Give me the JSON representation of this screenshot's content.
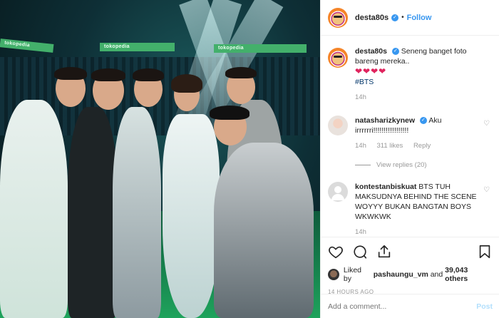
{
  "post": {
    "username": "desta80s",
    "follow_label": "Follow",
    "dot": "•",
    "caption_text": "Seneng banget foto bareng mereka..",
    "caption_hearts": "❤❤❤❤",
    "caption_tag": "#BTS",
    "caption_age": "14h",
    "banner_text": "tokopedia"
  },
  "comments": [
    {
      "username": "natasharizkynew",
      "text": "Aku irrrrrri!!!!!!!!!!!!!!!!!",
      "age": "14h",
      "likes": "311 likes",
      "reply": "Reply",
      "view_replies": "View replies (20)"
    },
    {
      "username": "kontestanbiskuat",
      "text": "BTS TUH MAKSUDNYA BEHIND THE SCENE WOYYY BUKAN BANGTAN BOYS WKWKWK",
      "age": "14h",
      "likes": "",
      "reply": ""
    }
  ],
  "actions": {
    "liked_by_prefix": "Liked by ",
    "liked_by_user": "pashaungu_vm",
    "liked_by_and": " and ",
    "liked_by_count": "39,043 others",
    "timestamp": "14 HOURS AGO"
  },
  "add_comment": {
    "placeholder": "Add a comment...",
    "post_label": "Post"
  },
  "colors": {
    "link": "#3897f0",
    "heart": "#e0245e",
    "banner": "#43b06b"
  },
  "icons": [
    "heart-icon",
    "comment-icon",
    "share-icon",
    "bookmark-icon",
    "verified-icon"
  ]
}
